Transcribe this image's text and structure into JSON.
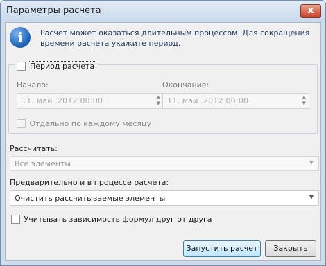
{
  "window": {
    "title": "Параметры расчета",
    "close_glyph": "x"
  },
  "info": {
    "icon": "info-icon",
    "icon_glyph": "i",
    "text": "Расчет может оказаться длительным процессом. Для сокращения времени расчета укажите период."
  },
  "period": {
    "checkbox_label": "Период расчета",
    "checked": false,
    "start": {
      "label": "Начало:",
      "value": "11. май .2012 00:00"
    },
    "end": {
      "label": "Окончание:",
      "value": "11. май .2012 00:00"
    },
    "monthly_label": "Отдельно по каждому месяцу"
  },
  "calculate": {
    "label": "Рассчитать:",
    "value": "Все элементы"
  },
  "pre": {
    "label": "Предварительно и в процессе расчета:",
    "value": "Очистить рассчитываемые элементы"
  },
  "dependency": {
    "label": "Учитывать зависимость формул друг от друга",
    "checked": false
  },
  "buttons": {
    "run": "Запустить расчет",
    "close": "Закрыть"
  }
}
